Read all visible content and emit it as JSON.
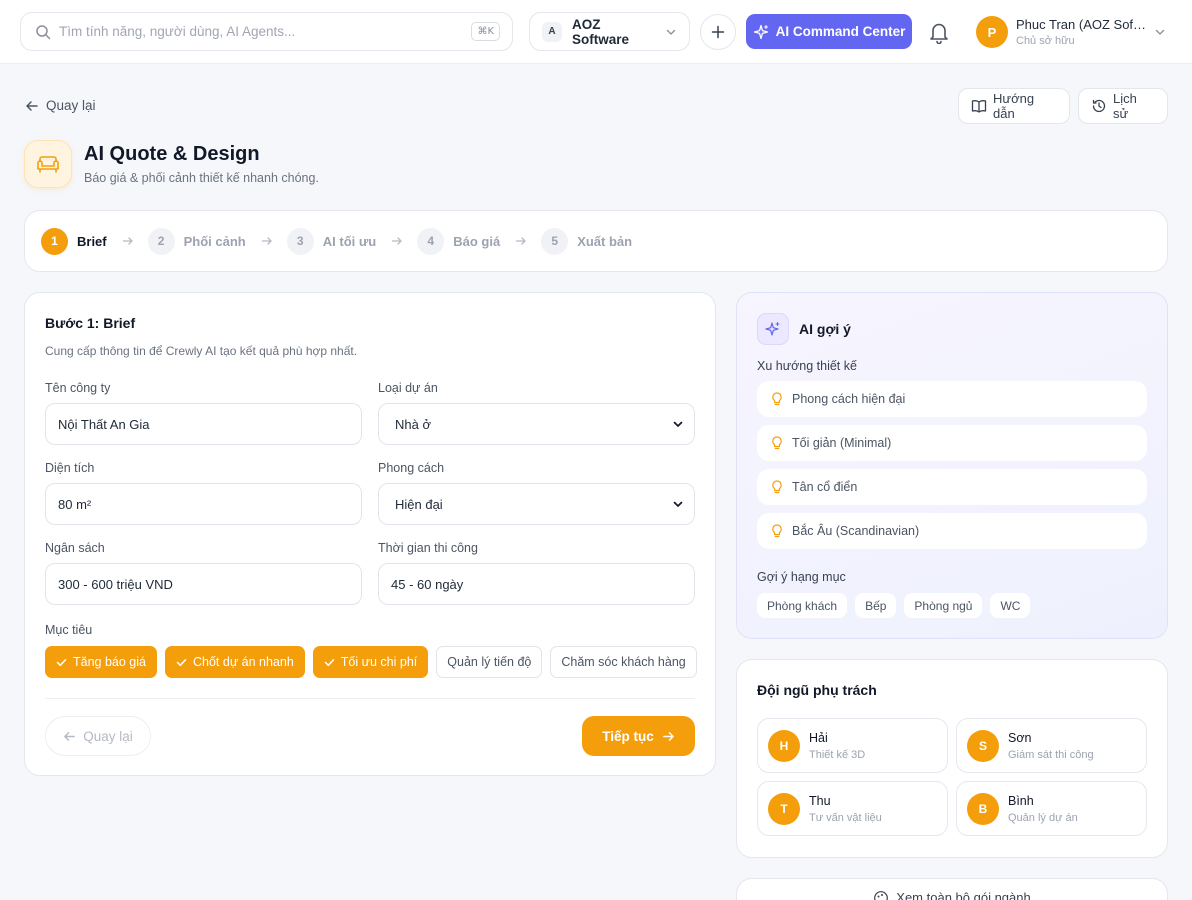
{
  "topbar": {
    "search_placeholder": "Tìm tính năng, người dùng, AI Agents...",
    "search_shortcut": "⌘K",
    "org_initial": "A",
    "org_name": "AOZ Software",
    "ai_command_label": "AI Command Center",
    "user_initial": "P",
    "user_name": "Phuc Tran (AOZ Software)",
    "user_role": "Chủ sở hữu"
  },
  "header": {
    "back_label": "Quay lại",
    "guide_label": "Hướng dẫn",
    "history_label": "Lịch sử",
    "app_title": "AI Quote & Design",
    "app_subtitle": "Báo giá & phối cảnh thiết kế nhanh chóng."
  },
  "steps": [
    {
      "num": "1",
      "label": "Brief",
      "active": true
    },
    {
      "num": "2",
      "label": "Phối cảnh",
      "active": false
    },
    {
      "num": "3",
      "label": "AI tối ưu",
      "active": false
    },
    {
      "num": "4",
      "label": "Báo giá",
      "active": false
    },
    {
      "num": "5",
      "label": "Xuất bản",
      "active": false
    }
  ],
  "form": {
    "title": "Bước 1: Brief",
    "description": "Cung cấp thông tin để Crewly AI tạo kết quả phù hợp nhất.",
    "company_label": "Tên công ty",
    "company_value": "Nội Thất An Gia",
    "project_type_label": "Loại dự án",
    "project_type_value": "Nhà ở",
    "area_label": "Diện tích",
    "area_value": "80 m²",
    "style_label": "Phong cách",
    "style_value": "Hiện đại",
    "budget_label": "Ngân sách",
    "budget_value": "300 - 600 triệu VND",
    "duration_label": "Thời gian thi công",
    "duration_value": "45 - 60 ngày",
    "goals_label": "Mục tiêu",
    "goals": [
      {
        "label": "Tăng báo giá",
        "selected": true
      },
      {
        "label": "Chốt dự án nhanh",
        "selected": true
      },
      {
        "label": "Tối ưu chi phí",
        "selected": true
      },
      {
        "label": "Quản lý tiến độ",
        "selected": false
      },
      {
        "label": "Chăm sóc khách hàng",
        "selected": false
      }
    ],
    "back_button": "Quay lại",
    "next_button": "Tiếp tục"
  },
  "ai_panel": {
    "title": "AI gợi ý",
    "trends_label": "Xu hướng thiết kế",
    "trends": [
      "Phong cách hiện đại",
      "Tối giản (Minimal)",
      "Tân cổ điển",
      "Bắc Âu (Scandinavian)"
    ],
    "categories_label": "Gợi ý hạng mục",
    "categories": [
      "Phòng khách",
      "Bếp",
      "Phòng ngủ",
      "WC"
    ]
  },
  "team": {
    "title": "Đội ngũ phụ trách",
    "members": [
      {
        "initial": "H",
        "name": "Hải",
        "role": "Thiết kế 3D"
      },
      {
        "initial": "S",
        "name": "Sơn",
        "role": "Giám sát thi công"
      },
      {
        "initial": "T",
        "name": "Thu",
        "role": "Tư vấn vật liệu"
      },
      {
        "initial": "B",
        "name": "Bình",
        "role": "Quản lý dự án"
      }
    ]
  },
  "footer_card": {
    "label": "Xem toàn bộ gói ngành"
  },
  "colors": {
    "accent": "#f59e0b",
    "primary": "#6366f1"
  }
}
